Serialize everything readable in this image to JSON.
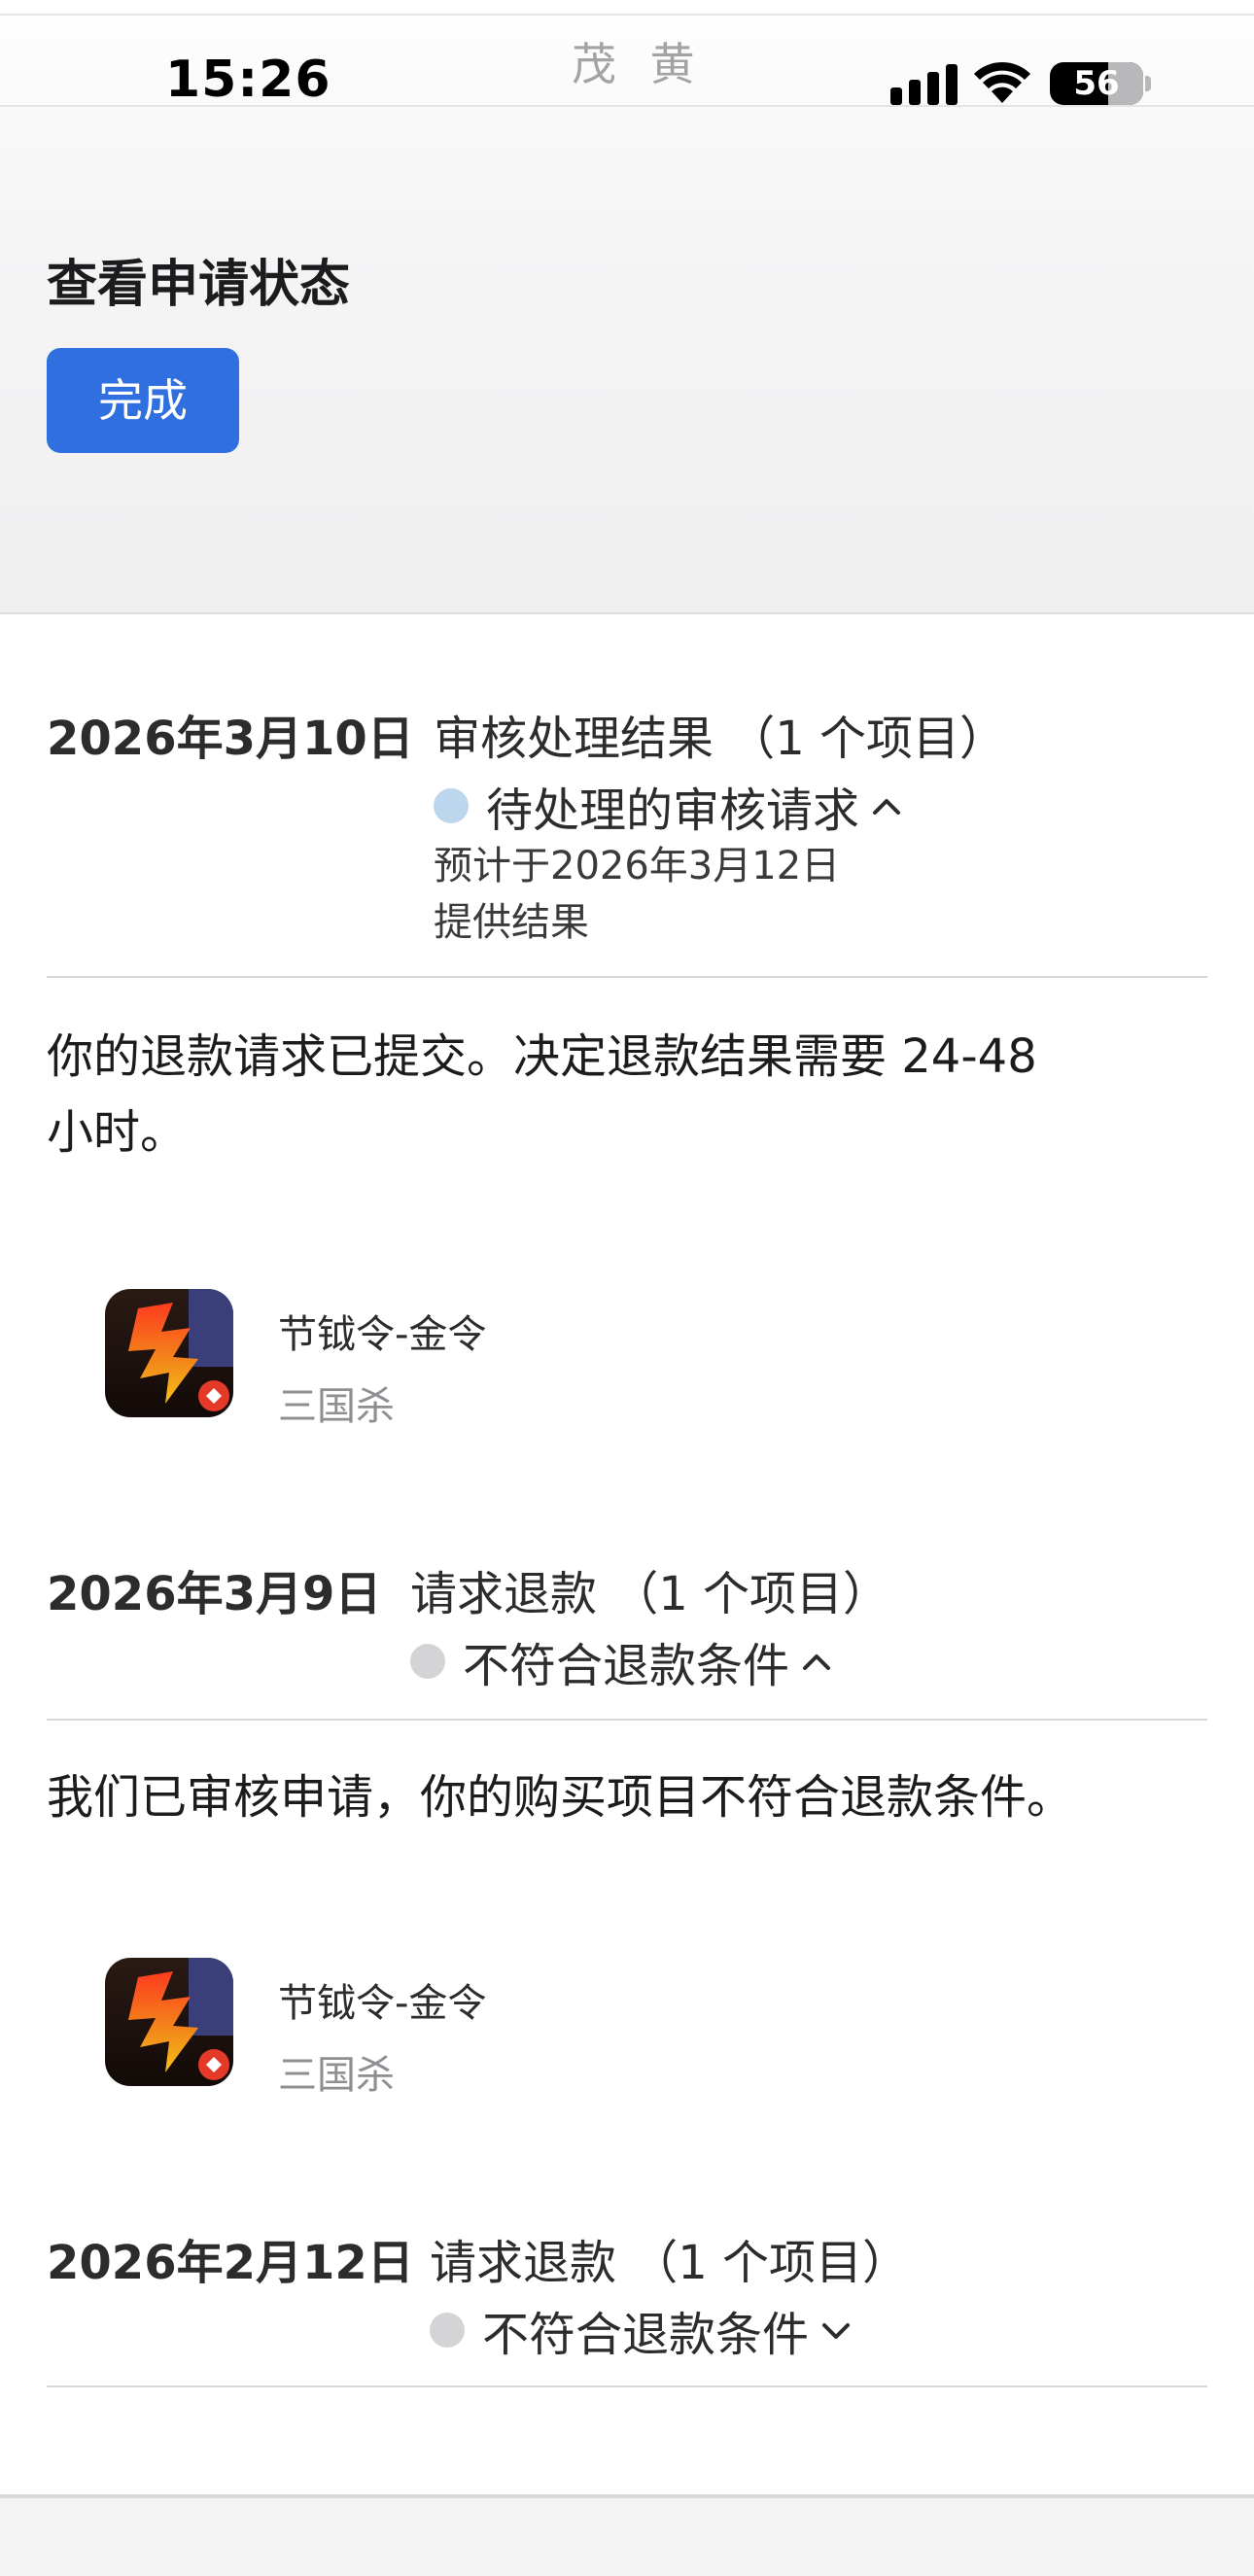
{
  "status_bar": {
    "time": "15:26",
    "center_text": "茂 黄",
    "battery": "56"
  },
  "header": {
    "title": "查看申请状态",
    "done_label": "完成"
  },
  "records": [
    {
      "date": "2026年3月10日",
      "type": "审核处理结果 （1 个项目）",
      "status": "待处理的审核请求",
      "status_color": "#bcd6ee",
      "expanded": true,
      "sub_lines": [
        "预计于2026年3月12日",
        "提供结果"
      ],
      "message_lines": [
        "你的退款请求已提交。决定退款结果需要 24-48",
        "小时。"
      ],
      "item": {
        "name": "节钺令-金令",
        "developer": "三国杀",
        "icon": "sanguosha-app-icon"
      }
    },
    {
      "date": "2026年3月9日",
      "type": "请求退款 （1 个项目）",
      "status": "不符合退款条件",
      "status_color": "#d4d4d6",
      "expanded": true,
      "message_lines": [
        "我们已审核申请，你的购买项目不符合退款条件。"
      ],
      "item": {
        "name": "节钺令-金令",
        "developer": "三国杀",
        "icon": "sanguosha-app-icon"
      }
    },
    {
      "date": "2026年2月12日",
      "type": "请求退款 （1 个项目）",
      "status": "不符合退款条件",
      "status_color": "#d4d4d6",
      "expanded": false
    }
  ],
  "colors": {
    "accent": "#2f6fdf",
    "pending_dot": "#bcd6ee",
    "ineligible_dot": "#d4d4d6"
  }
}
